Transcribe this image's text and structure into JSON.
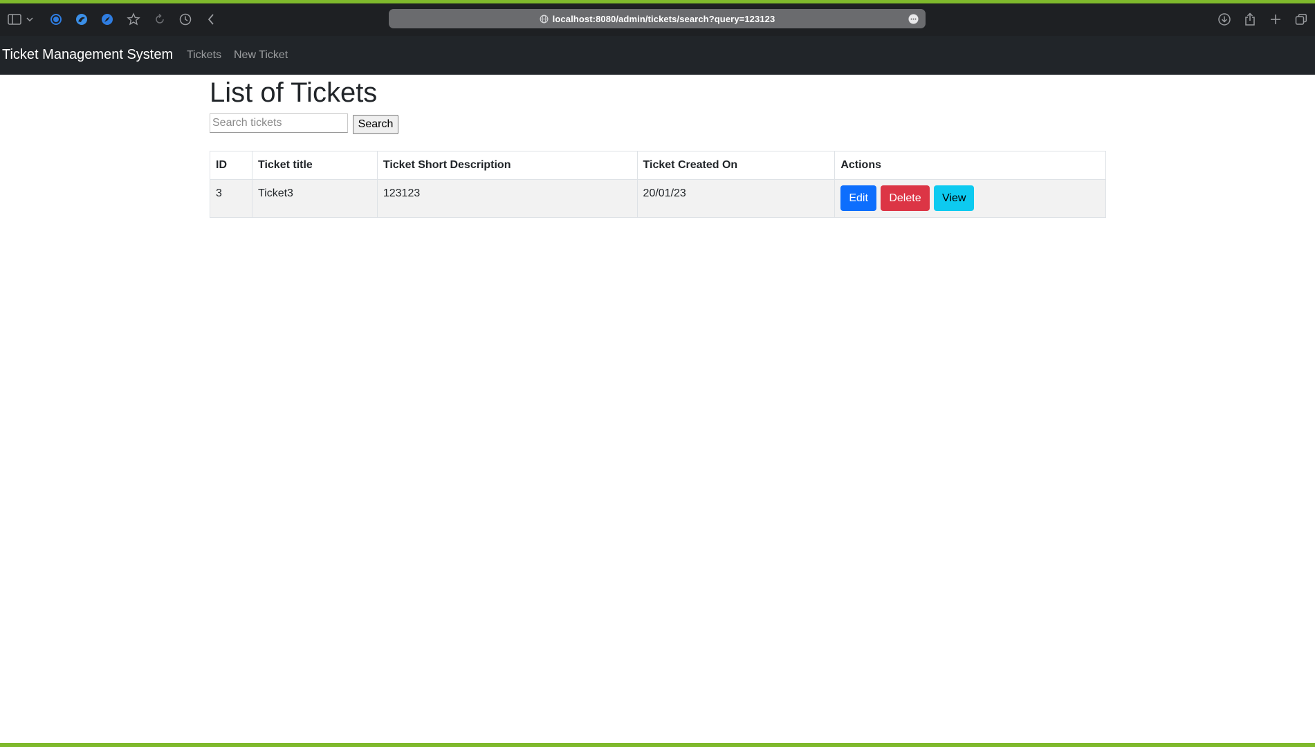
{
  "colors": {
    "accent_green": "#7fb92c",
    "chrome_bg": "#1e2023",
    "navbar_bg": "#212529",
    "edit_blue": "#0d6efd",
    "delete_red": "#dc3545",
    "view_cyan": "#0dcaf0"
  },
  "browser": {
    "url": "localhost:8080/admin/tickets/search?query=123123",
    "icons_left": [
      "sidebar-icon",
      "chevron-down-icon",
      "extension-blue-circle-icon",
      "extension-blue-bird-icon",
      "extension-blue-compass-icon",
      "star-icon",
      "reload-icon",
      "history-icon",
      "back-icon"
    ],
    "icons_right": [
      "download-icon",
      "share-icon",
      "plus-icon",
      "tabs-overview-icon"
    ]
  },
  "navbar": {
    "brand": "Ticket Management System",
    "links": [
      "Tickets",
      "New Ticket"
    ]
  },
  "main": {
    "title": "List of Tickets",
    "search": {
      "placeholder": "Search tickets",
      "value": "",
      "button_label": "Search"
    },
    "table": {
      "headers": [
        "ID",
        "Ticket title",
        "Ticket Short Description",
        "Ticket Created On",
        "Actions"
      ],
      "rows": [
        {
          "id": "3",
          "title": "Ticket3",
          "description": "123123",
          "created_on": "20/01/23",
          "actions": [
            "Edit",
            "Delete",
            "View"
          ]
        }
      ]
    }
  }
}
